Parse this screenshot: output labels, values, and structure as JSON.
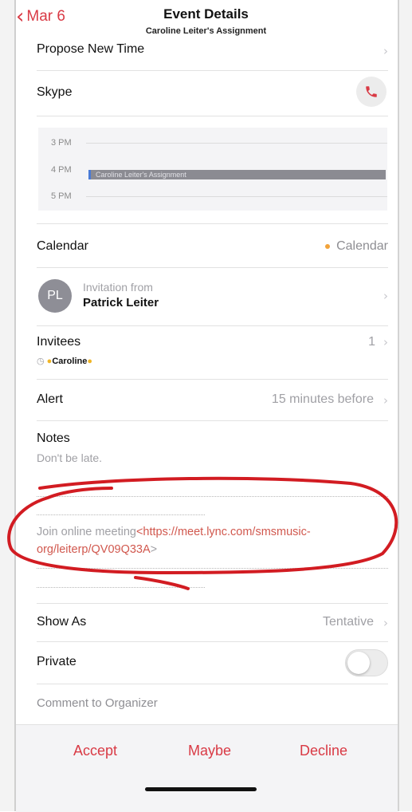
{
  "header": {
    "back_label": "Mar 6",
    "title": "Event Details",
    "subtitle": "Caroline Leiter's Assignment"
  },
  "rows": {
    "propose_new_time": "Propose New Time",
    "skype": "Skype",
    "calendar_label": "Calendar",
    "calendar_value": "Calendar",
    "calendar_dot_color": "#f2a33a",
    "invitation_from": "Invitation from",
    "organizer_name": "Patrick Leiter",
    "organizer_initials": "PL",
    "invitees_label": "Invitees",
    "invitees_count": "1",
    "invitee_name": "Caroline",
    "alert_label": "Alert",
    "alert_value": "15 minutes before",
    "notes_label": "Notes",
    "notes_text": "Don't be late.",
    "join_text": "Join online meeting",
    "join_link_line1": "<https://meet.lync.com/smsmusic-",
    "join_link_line2": "org/leiterp/QV09Q33A",
    "join_link_end": ">",
    "show_as_label": "Show As",
    "show_as_value": "Tentative",
    "private_label": "Private",
    "comment_label": "Comment to Organizer"
  },
  "calendar_preview": {
    "hours": [
      "3 PM",
      "4 PM",
      "5 PM"
    ],
    "event_title": "Caroline Leiter's Assignment"
  },
  "actions": {
    "accept": "Accept",
    "maybe": "Maybe",
    "decline": "Decline"
  },
  "colors": {
    "accent": "#d93a45",
    "annotation": "#d21c22"
  }
}
